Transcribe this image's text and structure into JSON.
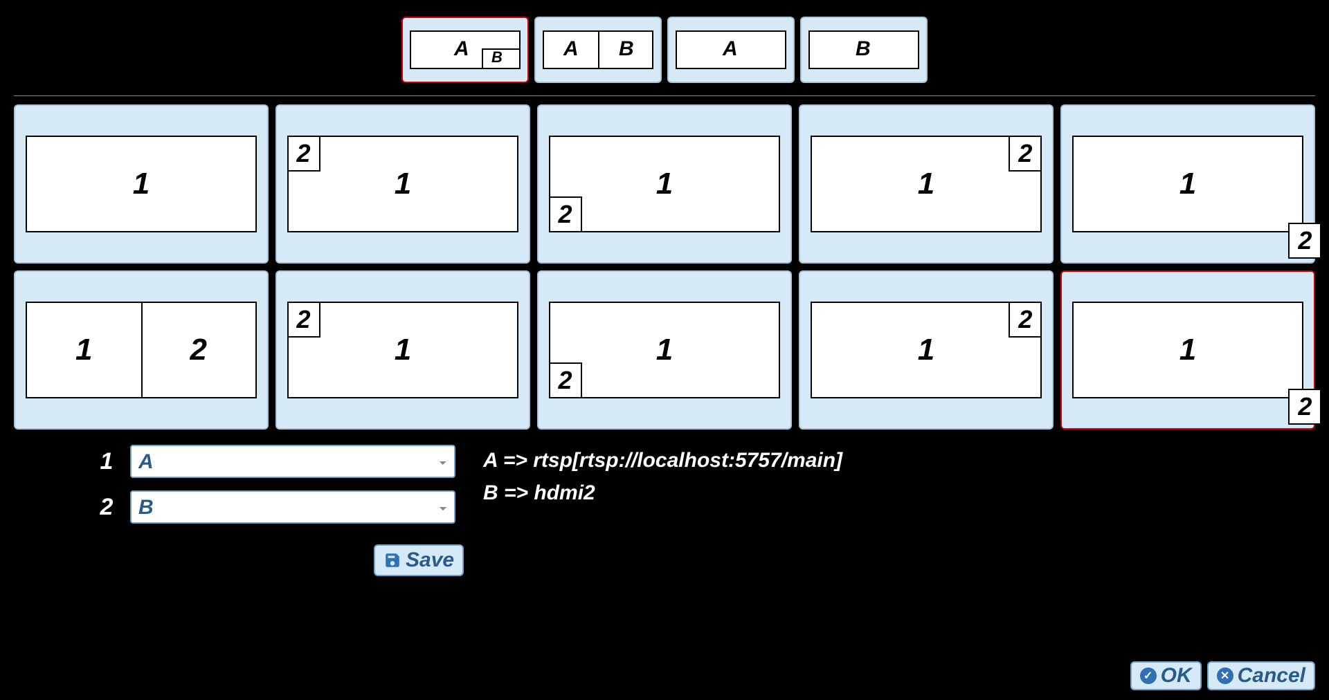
{
  "top_options": {
    "selected": 0,
    "items": [
      {
        "a": "A",
        "b": "B",
        "kind": "pip"
      },
      {
        "a": "A",
        "b": "B",
        "kind": "split"
      },
      {
        "a": "A",
        "kind": "solo_a"
      },
      {
        "b": "B",
        "kind": "solo_b"
      }
    ]
  },
  "grid": {
    "selected": 9,
    "cells": [
      {
        "main": "1"
      },
      {
        "main": "1",
        "pip": "2",
        "corner": "tl"
      },
      {
        "main": "1",
        "pip": "2",
        "corner": "bl"
      },
      {
        "main": "1",
        "pip": "2",
        "corner": "tr"
      },
      {
        "main": "1",
        "pip": "2",
        "corner": "br_out"
      },
      {
        "split_left": "1",
        "split_right": "2"
      },
      {
        "main": "1",
        "pip": "2",
        "corner": "tl"
      },
      {
        "main": "1",
        "pip": "2",
        "corner": "bl"
      },
      {
        "main": "1",
        "pip": "2",
        "corner": "tr"
      },
      {
        "main": "1",
        "pip": "2",
        "corner": "br_out"
      }
    ]
  },
  "assignments": {
    "rows": [
      {
        "index": "1",
        "value": "A"
      },
      {
        "index": "2",
        "value": "B"
      }
    ],
    "options": [
      "A",
      "B"
    ]
  },
  "mappings": [
    "A => rtsp[rtsp://localhost:5757/main]",
    "B => hdmi2"
  ],
  "buttons": {
    "save": "Save",
    "ok": "OK",
    "cancel": "Cancel"
  }
}
